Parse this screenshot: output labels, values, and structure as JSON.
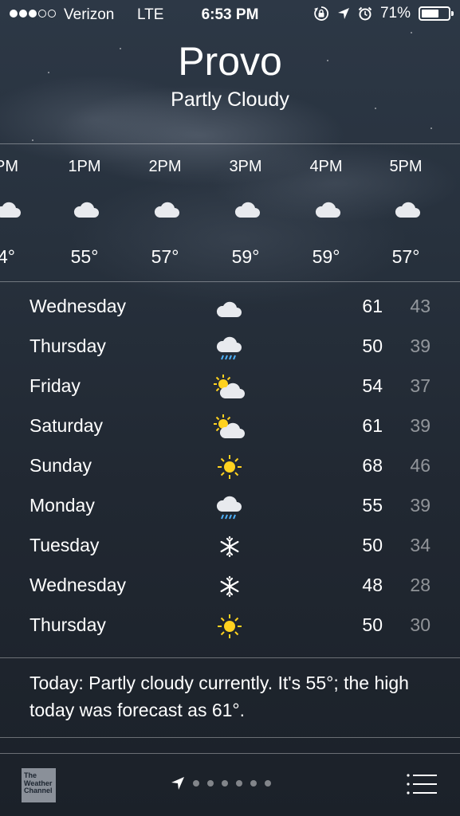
{
  "status_bar": {
    "carrier": "Verizon",
    "network": "LTE",
    "time": "6:53 PM",
    "battery": "71%",
    "battery_level": 0.71,
    "signal_bars": 3,
    "signal_total": 5
  },
  "location": {
    "city": "Provo",
    "condition": "Partly Cloudy"
  },
  "hourly": [
    {
      "time": "PM",
      "temp": "4°",
      "icon": "cloud-icon"
    },
    {
      "time": "1PM",
      "temp": "55°",
      "icon": "cloud-icon"
    },
    {
      "time": "2PM",
      "temp": "57°",
      "icon": "cloud-icon"
    },
    {
      "time": "3PM",
      "temp": "59°",
      "icon": "cloud-icon"
    },
    {
      "time": "4PM",
      "temp": "59°",
      "icon": "cloud-icon"
    },
    {
      "time": "5PM",
      "temp": "57°",
      "icon": "cloud-icon"
    }
  ],
  "daily": [
    {
      "day": "Wednesday",
      "icon": "cloud-icon",
      "high": "61",
      "low": "43"
    },
    {
      "day": "Thursday",
      "icon": "rain-icon",
      "high": "50",
      "low": "39"
    },
    {
      "day": "Friday",
      "icon": "partly-sunny-icon",
      "high": "54",
      "low": "37"
    },
    {
      "day": "Saturday",
      "icon": "partly-sunny-icon",
      "high": "61",
      "low": "39"
    },
    {
      "day": "Sunday",
      "icon": "sun-icon",
      "high": "68",
      "low": "46"
    },
    {
      "day": "Monday",
      "icon": "rain-icon",
      "high": "55",
      "low": "39"
    },
    {
      "day": "Tuesday",
      "icon": "snow-icon",
      "high": "50",
      "low": "34"
    },
    {
      "day": "Wednesday",
      "icon": "snow-icon",
      "high": "48",
      "low": "28"
    },
    {
      "day": "Thursday",
      "icon": "sun-icon",
      "high": "50",
      "low": "30"
    }
  ],
  "summary": "Today: Partly cloudy currently. It's 55°; the high today was forecast as 61°.",
  "footer": {
    "brand_line1": "The",
    "brand_line2": "Weather",
    "brand_line3": "Channel",
    "page_dots": 6
  },
  "colors": {
    "sun": "#ffd21f",
    "rain": "#4fb3ff",
    "cloud": "#e8eaee"
  }
}
